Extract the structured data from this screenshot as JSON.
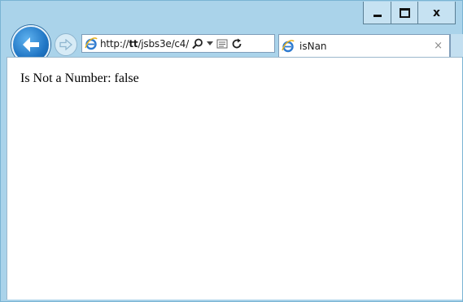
{
  "window": {
    "caption_buttons": {
      "minimize_icon": "minimize-icon",
      "maximize_icon": "maximize-icon",
      "close_label": "x"
    }
  },
  "navigation": {
    "back_icon": "back-arrow-icon",
    "forward_icon": "forward-arrow-icon"
  },
  "address_bar": {
    "url_prefix": "http://",
    "url_host": "tt",
    "url_path": "/jsbs3e/c4/",
    "search_icon": "search-icon",
    "dropdown_icon": "chevron-down-icon",
    "compat_icon": "compatibility-view-icon",
    "refresh_icon": "refresh-icon"
  },
  "tab": {
    "title": "isNan",
    "close_label": "×"
  },
  "page": {
    "text": "Is Not a Number: false"
  },
  "colors": {
    "frame": "#aad3ea",
    "back_button": "#1f75c4"
  }
}
